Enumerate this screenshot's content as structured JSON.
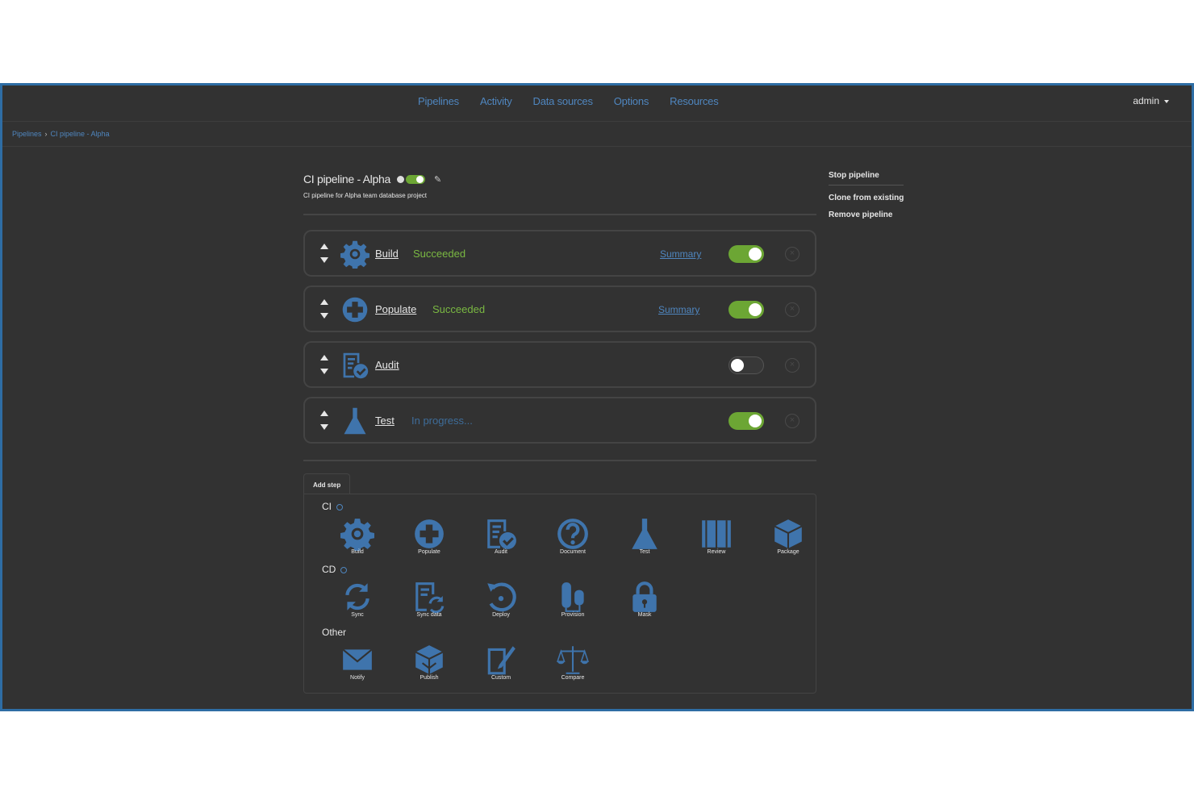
{
  "nav": {
    "links": [
      "Pipelines",
      "Activity",
      "Data sources",
      "Options",
      "Resources"
    ],
    "user": "admin"
  },
  "breadcrumb": {
    "root": "Pipelines",
    "current": "CI pipeline - Alpha"
  },
  "pipeline": {
    "title": "CI pipeline - Alpha",
    "description": "CI pipeline for Alpha team database project",
    "enabled": true
  },
  "steps": [
    {
      "name": "Build",
      "status": "Succeeded",
      "summary": "Summary",
      "enabled": true,
      "icon": "gear-icon"
    },
    {
      "name": "Populate",
      "status": "Succeeded",
      "summary": "Summary",
      "enabled": true,
      "icon": "plus-circle-icon"
    },
    {
      "name": "Audit",
      "status": "",
      "summary": "",
      "enabled": false,
      "icon": "audit-icon"
    },
    {
      "name": "Test",
      "status": "In progress...",
      "summary": "",
      "enabled": true,
      "icon": "flask-icon"
    }
  ],
  "add_step": {
    "tab_label": "Add step",
    "groups": [
      {
        "label": "CI",
        "items": [
          "Build",
          "Populate",
          "Audit",
          "Document",
          "Test",
          "Review",
          "Package"
        ]
      },
      {
        "label": "CD",
        "items": [
          "Sync",
          "Sync data",
          "Deploy",
          "Provision",
          "Mask"
        ]
      },
      {
        "label": "Other",
        "items": [
          "Notify",
          "Publish",
          "Custom",
          "Compare"
        ]
      }
    ]
  },
  "side_actions": {
    "stop": "Stop pipeline",
    "clone": "Clone from existing",
    "remove": "Remove pipeline"
  },
  "colors": {
    "accent": "#3f74ac",
    "success": "#7ab842",
    "toggle_on": "#6ca634",
    "background": "#323232"
  }
}
